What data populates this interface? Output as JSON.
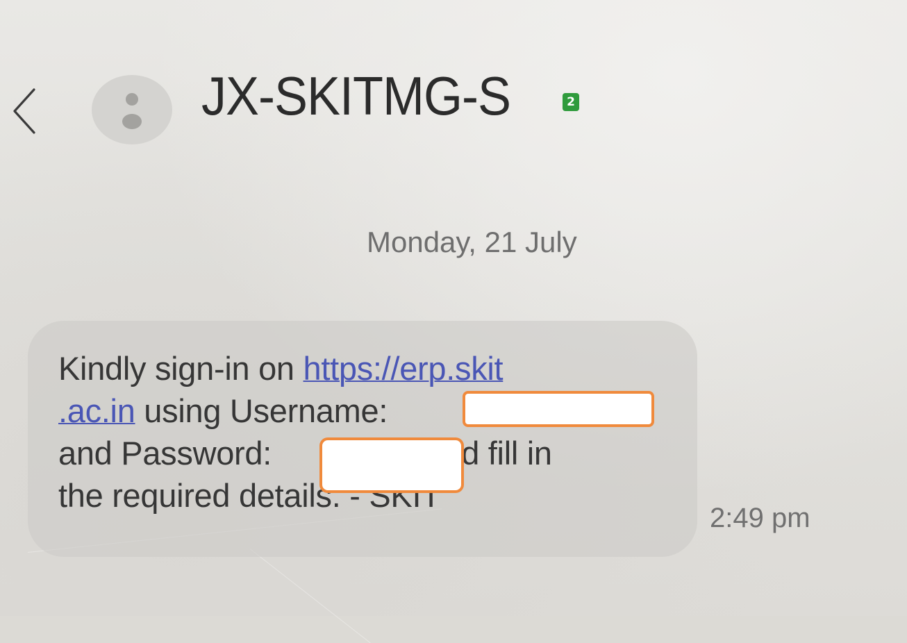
{
  "header": {
    "back_icon": "chevron-left-icon",
    "avatar_icon": "person-icon",
    "sender": "JX-SKITMG-S",
    "sim_badge": "2",
    "sim_badge_color": "#2f9b3c"
  },
  "conversation": {
    "date": "Monday, 21 July",
    "message": {
      "line1_text": "Kindly sign-in on ",
      "link_part1": "https://erp.skit",
      "link_part2": ".ac.in",
      "line2_text": " using Username: ",
      "line3_text_before": "and Password: ",
      "line3_text_after": " and fill in",
      "line4_text": "the required details. - SKIT",
      "link_color": "#4a56b5"
    },
    "time": "2:49 pm"
  },
  "redaction": {
    "border_color": "#f08a3c",
    "fill_color": "#ffffff"
  }
}
